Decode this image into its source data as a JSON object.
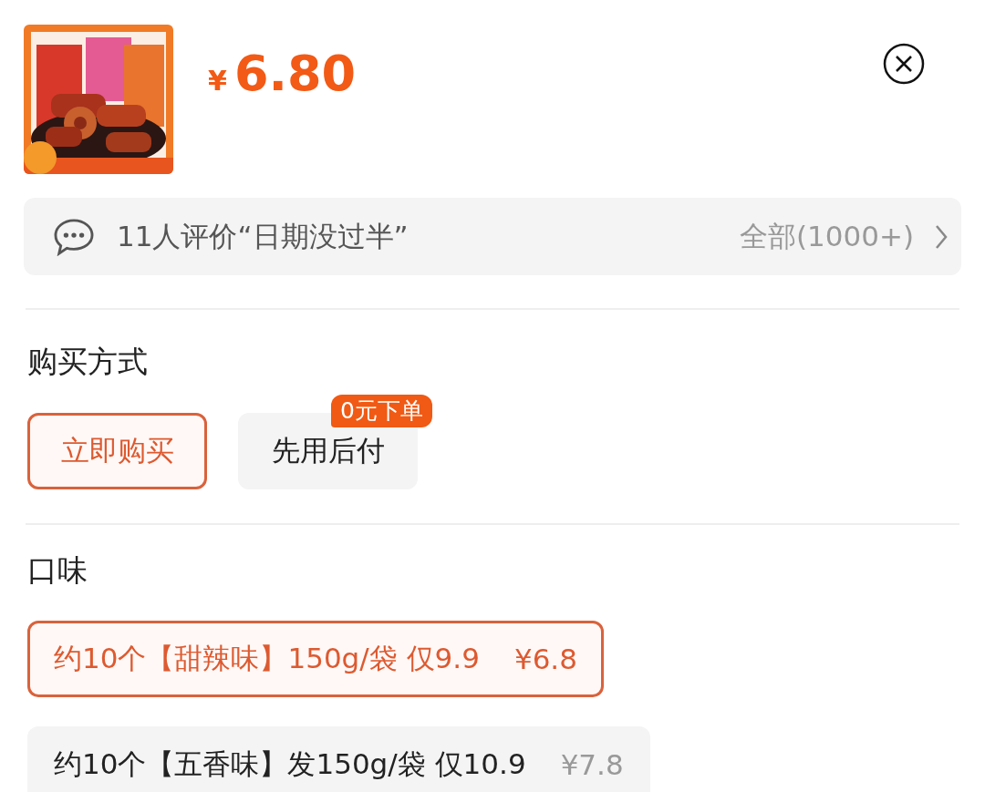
{
  "product": {
    "currency": "¥",
    "price": "6.80"
  },
  "reviews": {
    "summary": "11人评价“日期没过半”",
    "all_link": "全部(1000+)"
  },
  "purchase_method": {
    "title": "购买方式",
    "options": [
      {
        "label": "立即购买",
        "selected": true
      },
      {
        "label": "先用后付",
        "selected": false,
        "badge": "0元下单"
      }
    ]
  },
  "flavor": {
    "title": "口味",
    "options": [
      {
        "label": "约10个【甜辣味】150g/袋 仅9.9",
        "price": "¥6.8",
        "selected": true
      },
      {
        "label": "约10个【五香味】发150g/袋 仅10.9",
        "price": "¥7.8",
        "selected": false
      }
    ]
  }
}
